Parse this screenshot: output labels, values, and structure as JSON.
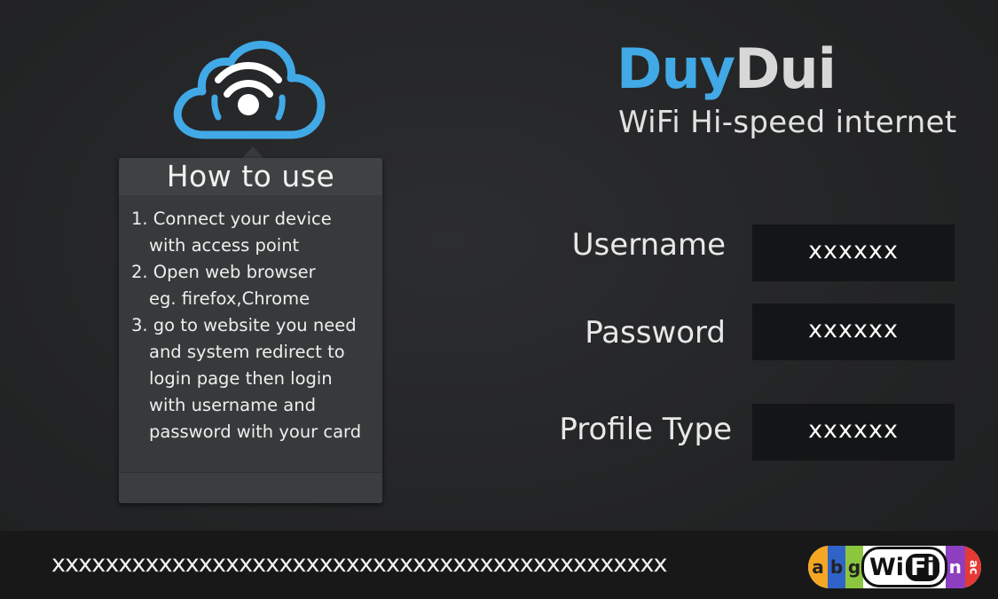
{
  "brand": {
    "name_part1": "Duy",
    "name_part2": "Dui",
    "tagline": "WiFi Hi-speed internet",
    "accent_color": "#41a9e6"
  },
  "logo": {
    "icon": "cloud-wifi-icon"
  },
  "how_to_use": {
    "title": "How to use",
    "lines": [
      "1. Connect your device",
      "with access point",
      "2. Open web browser",
      "eg. firefox,Chrome",
      "3. go to website you need",
      "and system redirect to",
      "login page then login",
      "with username and",
      "password with your card"
    ]
  },
  "fields": [
    {
      "label": "Username",
      "value": "xxxxxx"
    },
    {
      "label": "Password",
      "value": "xxxxxx"
    },
    {
      "label": "Profile Type",
      "value": "xxxxxx"
    }
  ],
  "footer": {
    "card_number": "xxxxxxxxxxxxxxxxxxxxxxxxxxxxxxxxxxxxxxxxxxxxxx",
    "wifi_badge": {
      "prefix": [
        "a",
        "b",
        "g"
      ],
      "word_wi": "Wi",
      "word_fi": "Fi",
      "suffix": [
        "n",
        "ac"
      ]
    }
  }
}
